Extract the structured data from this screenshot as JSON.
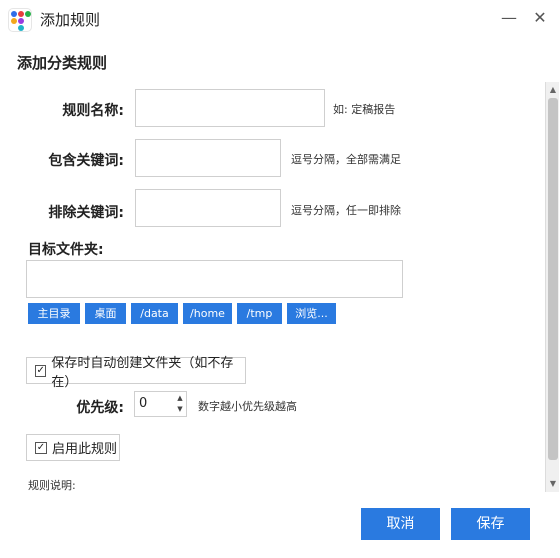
{
  "window": {
    "title": "添加规则",
    "minimize_glyph": "—",
    "close_glyph": "✕",
    "app_icon_colors": [
      "#2f6de8",
      "#e83f3f",
      "#27b04a",
      "#f2a81d",
      "#9a3de0",
      "#1fb3c9"
    ]
  },
  "heading": "添加分类规则",
  "form": {
    "rule_name_label": "规则名称:",
    "rule_name_value": "",
    "rule_name_hint": "如: 定稿报告",
    "include_label": "包含关键词:",
    "include_value": "",
    "include_hint": "逗号分隔，全部需满足",
    "exclude_label": "排除关键词:",
    "exclude_value": "",
    "exclude_hint": "逗号分隔，任一即排除",
    "target_label": "目标文件夹:",
    "target_value": "",
    "path_buttons": [
      "主目录",
      "桌面",
      "/data",
      "/home",
      "/tmp",
      "浏览..."
    ],
    "auto_create_label": "保存时自动创建文件夹（如不存在）",
    "auto_create_checked": true,
    "priority_label": "优先级:",
    "priority_value": "0",
    "priority_hint": "数字越小优先级越高",
    "enable_label": "启用此规则",
    "enable_checked": true,
    "rule_desc_label": "规则说明:"
  },
  "footer": {
    "cancel_label": "取消",
    "save_label": "保存"
  },
  "colors": {
    "accent": "#2a7ae0"
  }
}
